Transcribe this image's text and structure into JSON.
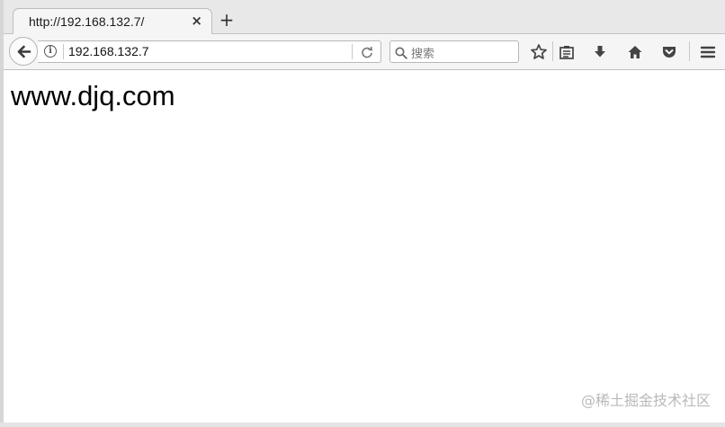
{
  "tab": {
    "title": "http://192.168.132.7/",
    "close_glyph": "×",
    "new_tab_glyph": "+"
  },
  "navbar": {
    "url": "192.168.132.7",
    "search_placeholder": "搜索"
  },
  "page": {
    "heading": "www.djq.com"
  },
  "watermark": {
    "text": "@稀土掘金技术社区"
  },
  "icons": {
    "back": "back-arrow-icon",
    "info": "info-icon",
    "reload": "reload-icon",
    "search": "search-icon",
    "bookmark": "star-icon",
    "reading_list": "clipboard-icon",
    "downloads": "download-arrow-icon",
    "home": "home-icon",
    "pocket": "pocket-icon",
    "menu": "hamburger-menu-icon"
  },
  "colors": {
    "chrome_bg": "#e8e8e8",
    "toolbar_bg": "#f5f5f5",
    "icon_color": "#444444"
  }
}
